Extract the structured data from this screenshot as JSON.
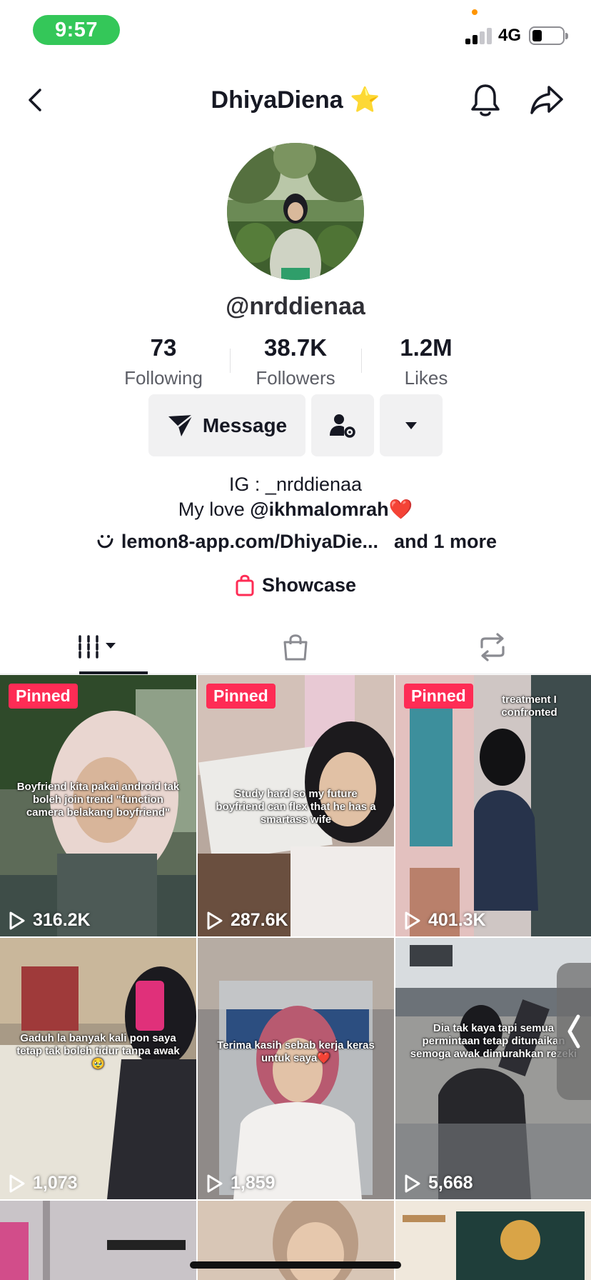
{
  "status_bar": {
    "time": "9:57",
    "network": "4G",
    "battery_percent": 30
  },
  "header": {
    "title": "DhiyaDiena ⭐"
  },
  "profile": {
    "username": "@nrddienaa",
    "stats": [
      {
        "value": "73",
        "label": "Following"
      },
      {
        "value": "38.7K",
        "label": "Followers"
      },
      {
        "value": "1.2M",
        "label": "Likes"
      }
    ],
    "actions": {
      "message_label": "Message"
    },
    "bio": {
      "line1": "IG : _nrddienaa",
      "line2_prefix": "My love ",
      "line2_mention": "@ikhmalomrah",
      "line2_suffix": "❤️",
      "link": "lemon8-app.com/DhiyaDie...",
      "link_more": "and 1 more"
    },
    "showcase_label": "Showcase"
  },
  "tabs": [
    {
      "name": "videos",
      "icon": "grid-videos-icon",
      "active": true
    },
    {
      "name": "shop",
      "icon": "shopping-bag-icon",
      "active": false
    },
    {
      "name": "reposts",
      "icon": "repost-icon",
      "active": false
    }
  ],
  "videos": [
    {
      "pinned_label": "Pinned",
      "views": "316.2K",
      "caption": "Boyfriend kita pakai android tak boleh join trend \"function camera belakang boyfriend\""
    },
    {
      "pinned_label": "Pinned",
      "views": "287.6K",
      "caption": "Study hard so my future boyfriend can flex that he has a smartass wife"
    },
    {
      "pinned_label": "Pinned",
      "views": "401.3K",
      "caption": "treatment I confronted"
    },
    {
      "pinned_label": "",
      "views": "1,073",
      "caption": "Gaduh la banyak kali pon saya tetap tak boleh tidur tanpa awak🥹"
    },
    {
      "pinned_label": "",
      "views": "1,859",
      "caption": "Terima kasih sebab kerja keras untuk saya❤️"
    },
    {
      "pinned_label": "",
      "views": "5,668",
      "caption": "Dia tak kaya tapi semua permintaan tetap ditunaikan semoga awak dimurahkan rezeki"
    }
  ],
  "colors": {
    "accent": "#fe2c55",
    "status_pill": "#34c759",
    "button_bg": "#f1f1f2",
    "text": "#161823"
  }
}
